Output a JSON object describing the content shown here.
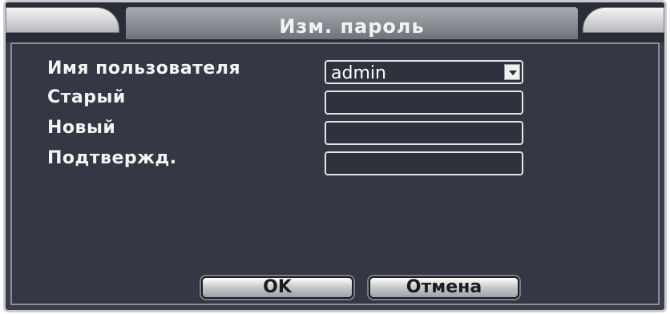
{
  "dialog": {
    "title": "Изм. пароль"
  },
  "form": {
    "username_label": "Имя пользователя",
    "username_value": "admin",
    "old_label": "Старый",
    "new_label": "Новый",
    "confirm_label": "Подтвержд."
  },
  "buttons": {
    "ok_label": "OK",
    "cancel_label": "Отмена"
  }
}
